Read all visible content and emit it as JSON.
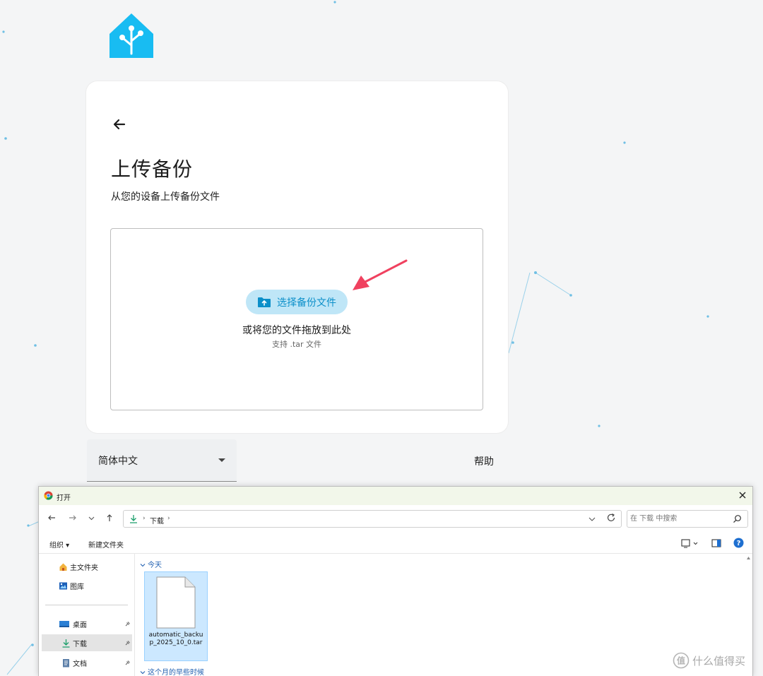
{
  "colors": {
    "brand": "#18bcf2",
    "button_bg": "#bfe6f7",
    "button_text": "#0b8fc9",
    "annotation_arrow": "#f0415f",
    "network_dots": "#9ad1ea"
  },
  "logo": {
    "icon": "home-assistant-logo"
  },
  "card": {
    "back_icon": "arrow-left-icon",
    "title": "上传备份",
    "subtitle": "从您的设备上传备份文件",
    "upload": {
      "button_label": "选择备份文件",
      "button_icon": "folder-upload-icon",
      "drop_hint": "或将您的文件拖放到此处",
      "support_text": "支持 .tar 文件"
    }
  },
  "footer": {
    "language": "简体中文",
    "help": "帮助"
  },
  "dialog": {
    "title": "打开",
    "address": {
      "folder": "下载",
      "separator": "›"
    },
    "search_placeholder": "在 下载 中搜索",
    "toolbar": {
      "organize": "组织 ▾",
      "new_folder": "新建文件夹"
    },
    "sidebar": [
      {
        "label": "主文件夹",
        "icon": "home-icon",
        "pinned": false
      },
      {
        "label": "图库",
        "icon": "gallery-icon",
        "pinned": false
      },
      {
        "label": "桌面",
        "icon": "desktop-icon",
        "pinned": true
      },
      {
        "label": "下载",
        "icon": "download-icon",
        "pinned": true,
        "active": true
      },
      {
        "label": "文档",
        "icon": "document-icon",
        "pinned": true
      }
    ],
    "groups": [
      {
        "label": "今天"
      },
      {
        "label": "这个月的早些时候"
      }
    ],
    "files": [
      {
        "name": "automatic_backup_2025_10_0.tar"
      }
    ]
  },
  "watermark": {
    "text": "什么值得买"
  }
}
